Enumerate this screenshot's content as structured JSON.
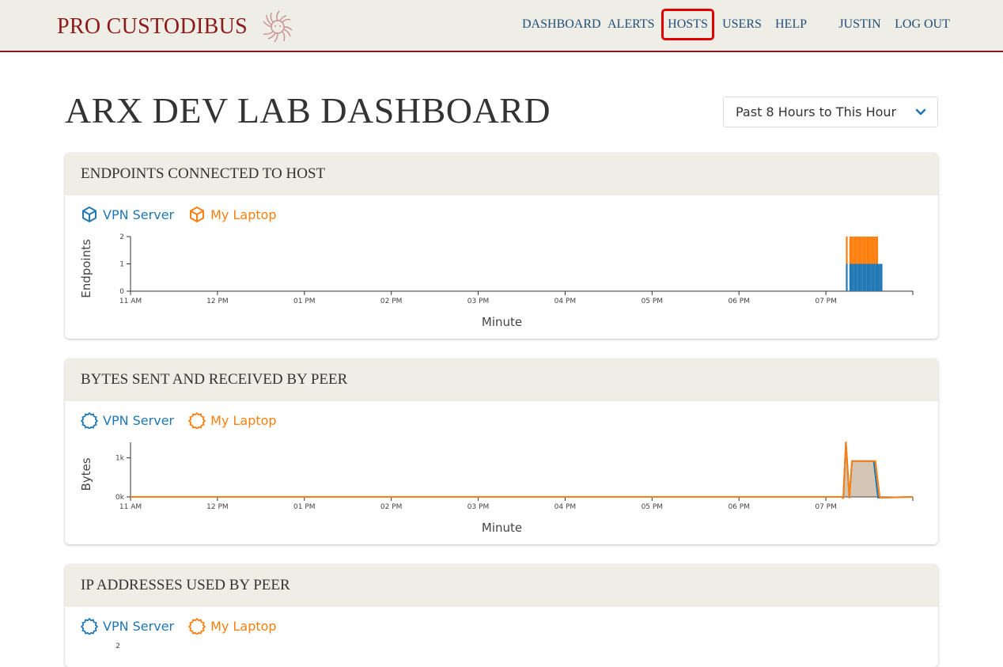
{
  "brand": {
    "name": "PRO CUSTODIBUS",
    "logo_icon": "medusa-logo-icon"
  },
  "nav": {
    "items": [
      {
        "label": "DASHBOARD",
        "highlighted": false
      },
      {
        "label": "ALERTS",
        "highlighted": false
      },
      {
        "label": "HOSTS",
        "highlighted": true
      },
      {
        "label": "USERS",
        "highlighted": false
      },
      {
        "label": "HELP",
        "highlighted": false
      },
      {
        "label": "JUSTIN",
        "highlighted": false
      },
      {
        "label": "LOG OUT",
        "highlighted": false
      }
    ]
  },
  "page": {
    "title": "ARX DEV LAB DASHBOARD"
  },
  "time_range": {
    "selected": "Past 8 Hours to This Hour",
    "icon": "chevron-down-icon"
  },
  "colors": {
    "vpn_server": "#1f77b4",
    "my_laptop": "#ff7f0e",
    "brand": "#8b1a1a",
    "nav": "#1f4e79",
    "header_bg": "#eeede6"
  },
  "cards": [
    {
      "title": "ENDPOINTS CONNECTED TO HOST",
      "legend_icon": "cube-icon",
      "legend": [
        "VPN Server",
        "My Laptop"
      ]
    },
    {
      "title": "BYTES SENT AND RECEIVED BY PEER",
      "legend_icon": "cog-icon",
      "legend": [
        "VPN Server",
        "My Laptop"
      ]
    },
    {
      "title": "IP ADDRESSES USED BY PEER",
      "legend_icon": "cog-icon",
      "legend": [
        "VPN Server",
        "My Laptop"
      ],
      "partial_y_tick": "2"
    }
  ],
  "chart_data": [
    {
      "type": "bar",
      "stacked": true,
      "title": "ENDPOINTS CONNECTED TO HOST",
      "xlabel": "Minute",
      "ylabel": "Endpoints",
      "x_range_hours": [
        11,
        20
      ],
      "x_ticks": [
        "11 AM",
        "12 PM",
        "01 PM",
        "02 PM",
        "03 PM",
        "04 PM",
        "05 PM",
        "06 PM",
        "07 PM"
      ],
      "y_ticks": [
        "0",
        "1",
        "2"
      ],
      "ylim": [
        0,
        2
      ],
      "bar_minutes": [
        19.23,
        19.25,
        19.27,
        19.28,
        19.3,
        19.32,
        19.33,
        19.35,
        19.37,
        19.38,
        19.4,
        19.42,
        19.43,
        19.45,
        19.47,
        19.48,
        19.5,
        19.52,
        19.53,
        19.55,
        19.57,
        19.58,
        19.6,
        19.62,
        19.63
      ],
      "series": [
        {
          "name": "VPN Server",
          "values": [
            1,
            0,
            1,
            1,
            1,
            1,
            1,
            1,
            1,
            1,
            1,
            1,
            1,
            1,
            1,
            1,
            1,
            1,
            1,
            1,
            1,
            1,
            1,
            1,
            1
          ]
        },
        {
          "name": "My Laptop",
          "values": [
            1,
            0,
            1,
            1,
            1,
            1,
            1,
            1,
            1,
            1,
            1,
            1,
            1,
            1,
            1,
            1,
            1,
            1,
            1,
            1,
            1,
            1,
            0,
            0,
            0
          ]
        }
      ]
    },
    {
      "type": "area",
      "title": "BYTES SENT AND RECEIVED BY PEER",
      "xlabel": "Minute",
      "ylabel": "Bytes",
      "x_range_hours": [
        11,
        20
      ],
      "x_ticks": [
        "11 AM",
        "12 PM",
        "01 PM",
        "02 PM",
        "03 PM",
        "04 PM",
        "05 PM",
        "06 PM",
        "07 PM"
      ],
      "y_ticks": [
        "0k",
        "1k"
      ],
      "ylim": [
        0,
        1400
      ],
      "series": [
        {
          "name": "VPN Server",
          "points": [
            [
              11,
              0
            ],
            [
              19.18,
              0
            ],
            [
              19.2,
              -30
            ],
            [
              19.23,
              1400
            ],
            [
              19.27,
              -20
            ],
            [
              19.3,
              920
            ],
            [
              19.55,
              920
            ],
            [
              19.6,
              -20
            ],
            [
              20,
              0
            ]
          ]
        },
        {
          "name": "My Laptop",
          "points": [
            [
              11,
              0
            ],
            [
              19.18,
              0
            ],
            [
              19.2,
              -30
            ],
            [
              19.23,
              1400
            ],
            [
              19.27,
              -20
            ],
            [
              19.3,
              920
            ],
            [
              19.57,
              920
            ],
            [
              19.62,
              -20
            ],
            [
              20,
              0
            ]
          ]
        }
      ]
    }
  ]
}
